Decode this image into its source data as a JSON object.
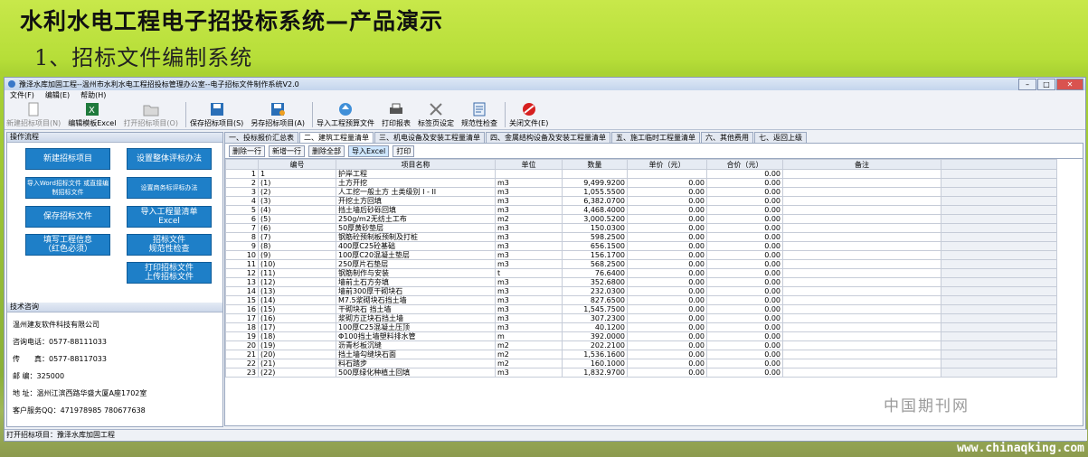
{
  "slide": {
    "title": "水利水电工程电子招投标系统—产品演示",
    "subtitle": "1、招标文件编制系统"
  },
  "window": {
    "title": "豫泽水库加固工程--温州市水利水电工程招投标管理办公室--电子招标文件制作系统V2.0"
  },
  "menu": [
    "文件(F)",
    "编辑(E)",
    "帮助(H)"
  ],
  "toolbar": [
    {
      "label": "新建招标项目(N)",
      "icon": "new-doc-icon",
      "enabled": false
    },
    {
      "label": "编辑模板Excel",
      "icon": "excel-icon",
      "enabled": true
    },
    {
      "label": "打开招标项目(O)",
      "icon": "folder-icon",
      "enabled": false
    },
    {
      "label": "保存招标项目(S)",
      "icon": "save-icon",
      "enabled": true
    },
    {
      "label": "另存招标项目(A)",
      "icon": "save-as-icon",
      "enabled": true
    },
    {
      "label": "导入工程预算文件",
      "icon": "import-icon",
      "enabled": true
    },
    {
      "label": "打印报表",
      "icon": "printer-icon",
      "enabled": true
    },
    {
      "label": "标签页设定",
      "icon": "tools-icon",
      "enabled": true
    },
    {
      "label": "规范性检查",
      "icon": "check-icon",
      "enabled": true
    },
    {
      "label": "关闭文件(E)",
      "icon": "close-file-icon",
      "enabled": true
    }
  ],
  "left": {
    "title": "操作流程",
    "buttons": [
      "新建招标项目",
      "设置整体评标办法",
      "导入Word招标文件\n或直接编制招标文件",
      "设置商务标评标办法",
      "保存招标文件",
      "导入工程量清单\nExcel",
      "填写工程信息\n（红色必须）",
      "招标文件\n规范性检查",
      "打印招标文件\n上传招标文件"
    ],
    "support_title": "技术咨询",
    "company": "温州建友软件科技有限公司",
    "phone": "咨询电话：0577-88111033",
    "fax": "传　　真：0577-88117033",
    "zip": "邮 编：325000",
    "address": "地 址：温州江滨西路华盛大厦A座1702室",
    "qq": "客户服务QQ：471978985 780677638"
  },
  "tabs": [
    "一、投标报价汇总表",
    "二、建筑工程量清单",
    "三、机电设备及安装工程量清单",
    "四、金属结构设备及安装工程量清单",
    "五、施工临时工程量清单",
    "六、其他费用",
    "七、返回上级"
  ],
  "active_tab": 1,
  "grid_buttons": [
    "删除一行",
    "新增一行",
    "删除全部",
    "导入Excel",
    "打印"
  ],
  "columns": [
    "编号",
    "项目名称",
    "单位",
    "数量",
    "单价（元）",
    "合价（元）",
    "备注"
  ],
  "rows": [
    [
      "1",
      "1",
      "护岸工程",
      "",
      "",
      "",
      "0.00"
    ],
    [
      "2",
      "(1)",
      "土方开挖",
      "m3",
      "9,499.9200",
      "0.00",
      "0.00"
    ],
    [
      "3",
      "(2)",
      "人工挖一般土方 土类级别 I - II",
      "m3",
      "1,055.5500",
      "0.00",
      "0.00"
    ],
    [
      "4",
      "(3)",
      "开挖土方回填",
      "m3",
      "6,382.0700",
      "0.00",
      "0.00"
    ],
    [
      "5",
      "(4)",
      "挡土墙后砂砾回填",
      "m3",
      "4,468.4000",
      "0.00",
      "0.00"
    ],
    [
      "6",
      "(5)",
      "250g/m2无纺土工布",
      "m2",
      "3,000.5200",
      "0.00",
      "0.00"
    ],
    [
      "7",
      "(6)",
      "50厚黄砂垫层",
      "m3",
      "150.0300",
      "0.00",
      "0.00"
    ],
    [
      "8",
      "(7)",
      "钢筋砼预制板预制及打桩",
      "m3",
      "598.2500",
      "0.00",
      "0.00"
    ],
    [
      "9",
      "(8)",
      "400厚C25砼基础",
      "m3",
      "656.1500",
      "0.00",
      "0.00"
    ],
    [
      "10",
      "(9)",
      "100厚C20混凝土垫层",
      "m3",
      "156.1700",
      "0.00",
      "0.00"
    ],
    [
      "11",
      "(10)",
      "250厚片石垫层",
      "m3",
      "568.2500",
      "0.00",
      "0.00"
    ],
    [
      "12",
      "(11)",
      "钢筋制作与安装",
      "t",
      "76.6400",
      "0.00",
      "0.00"
    ],
    [
      "13",
      "(12)",
      "墙前土石方夯填",
      "m3",
      "352.6800",
      "0.00",
      "0.00"
    ],
    [
      "14",
      "(13)",
      "墙前300厚干砌块石",
      "m3",
      "232.0300",
      "0.00",
      "0.00"
    ],
    [
      "15",
      "(14)",
      "M7.5浆砌块石挡土墙",
      "m3",
      "827.6500",
      "0.00",
      "0.00"
    ],
    [
      "16",
      "(15)",
      "干砌块石 挡土墙",
      "m3",
      "1,545.7500",
      "0.00",
      "0.00"
    ],
    [
      "17",
      "(16)",
      "浆砌方正块石挡土墙",
      "m3",
      "307.2300",
      "0.00",
      "0.00"
    ],
    [
      "18",
      "(17)",
      "100厚C25混凝土压顶",
      "m3",
      "40.1200",
      "0.00",
      "0.00"
    ],
    [
      "19",
      "(18)",
      "Φ100挡土墙塑料排水管",
      "m",
      "392.0000",
      "0.00",
      "0.00"
    ],
    [
      "20",
      "(19)",
      "沥青杉板沉缝",
      "m2",
      "202.2100",
      "0.00",
      "0.00"
    ],
    [
      "21",
      "(20)",
      "挡土墙勾缝块石面",
      "m2",
      "1,536.1600",
      "0.00",
      "0.00"
    ],
    [
      "22",
      "(21)",
      "料石踏步",
      "m2",
      "160.1000",
      "0.00",
      "0.00"
    ],
    [
      "23",
      "(22)",
      "500厚绿化种植土回填",
      "m3",
      "1,832.9700",
      "0.00",
      "0.00"
    ]
  ],
  "status": "打开招标项目：豫泽水库加固工程",
  "watermark": "中国期刊网",
  "watermark_url": "www.chinaqking.com"
}
